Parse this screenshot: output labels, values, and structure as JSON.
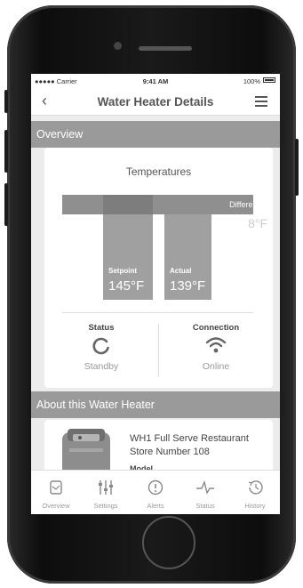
{
  "status_bar": {
    "carrier": "●●●●● Carrier",
    "time": "9:41 AM",
    "battery": "100%"
  },
  "nav": {
    "back_icon": "chevron-left-icon",
    "title": "Water Heater Details",
    "menu_icon": "hamburger-menu-icon"
  },
  "overview": {
    "header": "Overview",
    "temperatures": {
      "title": "Temperatures",
      "differential_label": "Differential",
      "differential_value": "8°F",
      "setpoint_label": "Setpoint",
      "setpoint_value": "145°F",
      "actual_label": "Actual",
      "actual_value": "139°F"
    },
    "status": {
      "title": "Status",
      "value": "Standby",
      "icon": "refresh-circle-icon"
    },
    "connection": {
      "title": "Connection",
      "value": "Online",
      "icon": "wifi-icon"
    }
  },
  "about": {
    "header": "About this Water Heater",
    "name": "WH1 Full Serve Restaurant Store Number 108",
    "sub_label": "Model"
  },
  "tabs": [
    {
      "label": "Overview",
      "icon": "overview-icon"
    },
    {
      "label": "Settings",
      "icon": "sliders-icon"
    },
    {
      "label": "Alerts",
      "icon": "alert-icon"
    },
    {
      "label": "Status",
      "icon": "pulse-icon"
    },
    {
      "label": "History",
      "icon": "history-icon"
    }
  ]
}
